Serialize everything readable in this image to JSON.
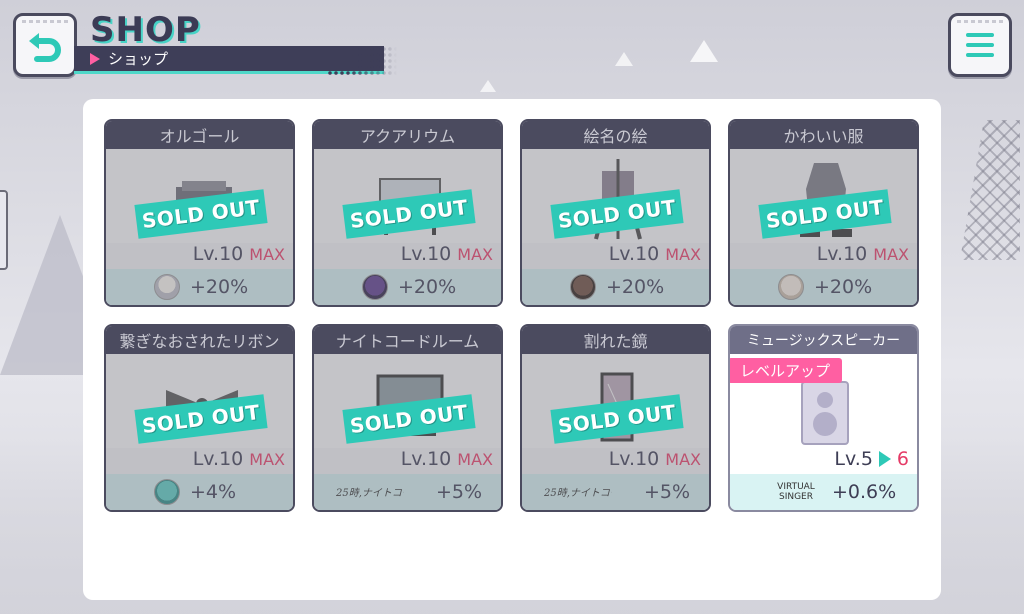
{
  "header": {
    "title_en": "SHOP",
    "title_jp": "ショップ"
  },
  "items": [
    {
      "name": "オルゴール",
      "level": "Lv.10",
      "max": "MAX",
      "bonus": "+20%",
      "status": "SOLD OUT",
      "icon": "music-box-icon"
    },
    {
      "name": "アクアリウム",
      "level": "Lv.10",
      "max": "MAX",
      "bonus": "+20%",
      "status": "SOLD OUT",
      "icon": "aquarium-icon"
    },
    {
      "name": "絵名の絵",
      "level": "Lv.10",
      "max": "MAX",
      "bonus": "+20%",
      "status": "SOLD OUT",
      "icon": "easel-icon"
    },
    {
      "name": "かわいい服",
      "level": "Lv.10",
      "max": "MAX",
      "bonus": "+20%",
      "status": "SOLD OUT",
      "icon": "clothes-icon"
    },
    {
      "name": "繋ぎなおされたリボン",
      "level": "Lv.10",
      "max": "MAX",
      "bonus": "+4%",
      "status": "SOLD OUT",
      "icon": "ribbon-icon"
    },
    {
      "name": "ナイトコードルーム",
      "level": "Lv.10",
      "max": "MAX",
      "bonus": "+5%",
      "status": "SOLD OUT",
      "icon": "monitor-icon"
    },
    {
      "name": "割れた鏡",
      "level": "Lv.10",
      "max": "MAX",
      "bonus": "+5%",
      "status": "SOLD OUT",
      "icon": "mirror-icon"
    },
    {
      "name": "ミュージックスピーカー",
      "tag": "レベルアップ",
      "level": "Lv.5",
      "next_level": "6",
      "bonus": "+0.6%",
      "logo": "VIRTUAL SINGER",
      "icon": "speaker-icon"
    }
  ],
  "colors": {
    "accent": "#2ec9b7",
    "pink": "#ff5fa2",
    "max_red": "#e53a66",
    "dark": "#4b4b5f"
  }
}
